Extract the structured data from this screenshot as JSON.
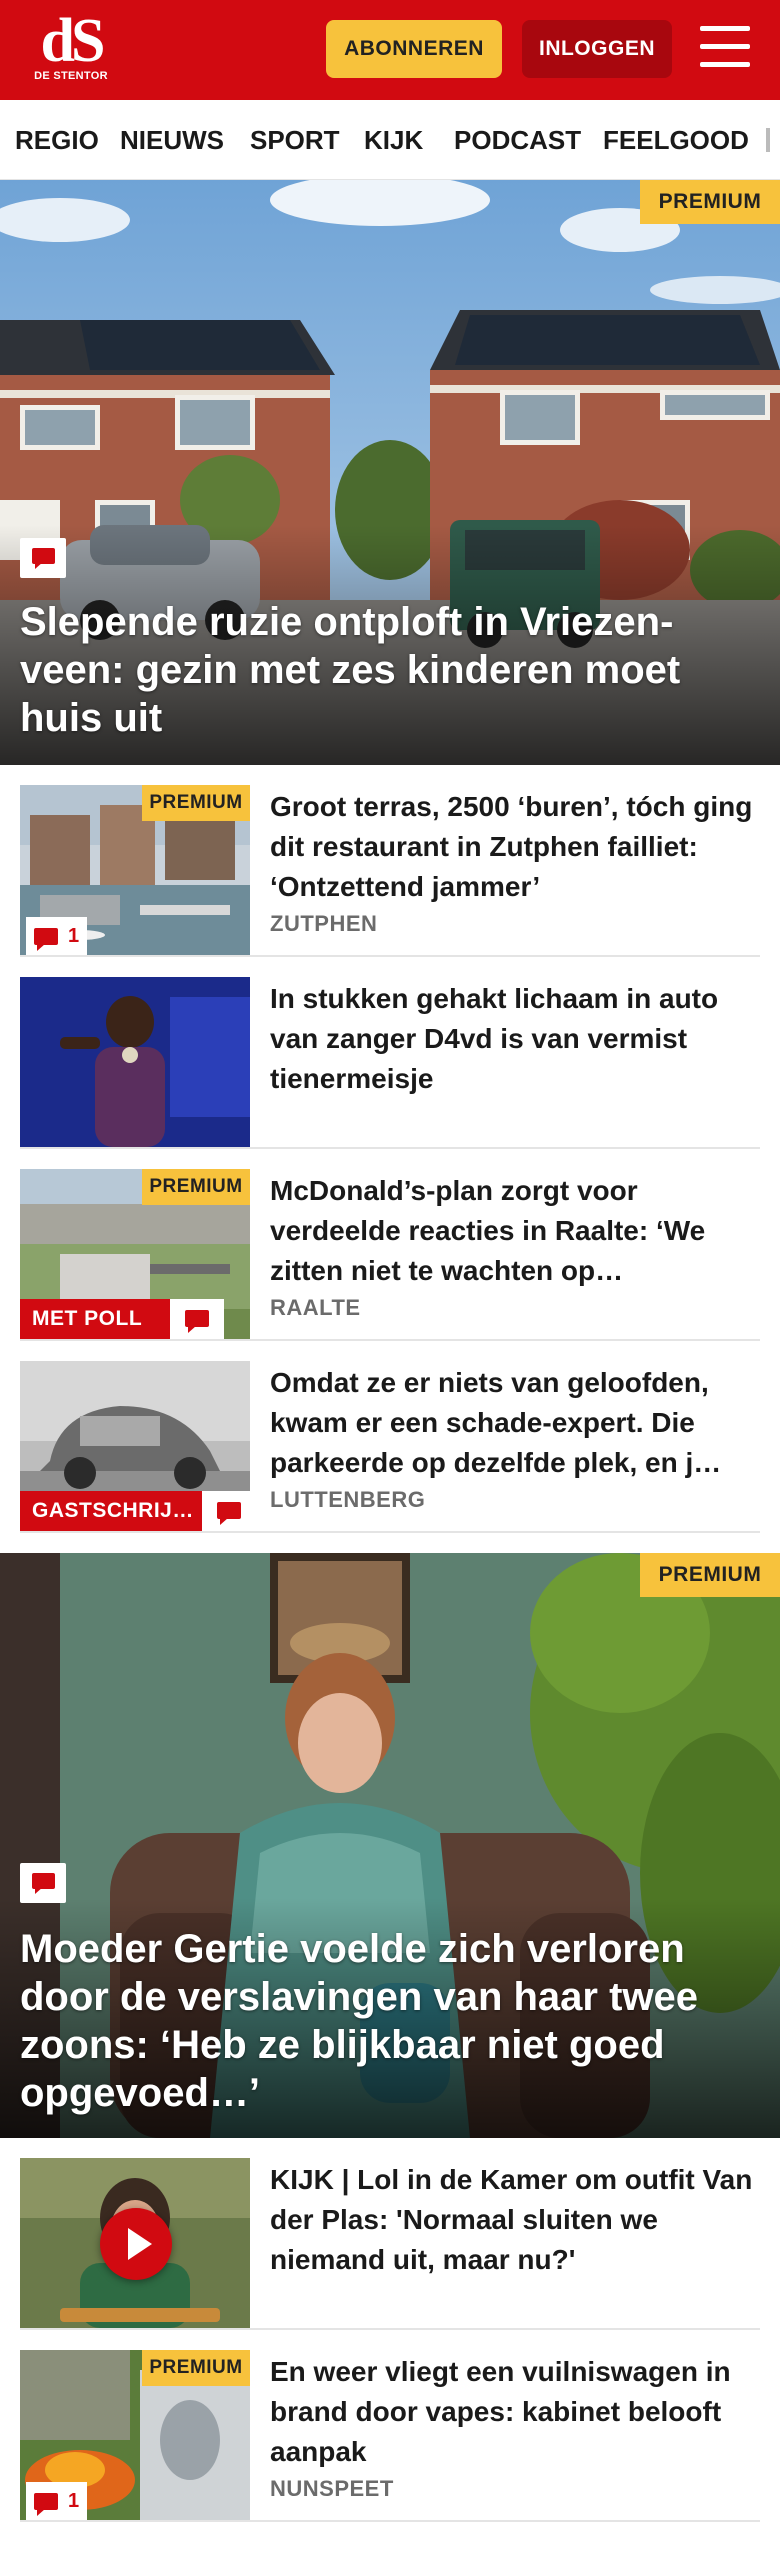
{
  "header": {
    "logo_mark": "dS",
    "logo_name": "DE STENTOR",
    "subscribe_label": "ABONNEREN",
    "login_label": "INLOGGEN",
    "brand_color": "#d10a11",
    "accent_color": "#f7c23c"
  },
  "nav": {
    "items": [
      "REGIO",
      "NIEUWS",
      "SPORT",
      "KIJK",
      "PODCAST",
      "FEELGOOD"
    ]
  },
  "badge": {
    "premium": "PREMIUM"
  },
  "hero1": {
    "title": "Slepende ruzie ontploft in Vriezen-veen: gezin met zes kinderen moet huis uit",
    "premium": true
  },
  "articles": [
    {
      "title": "Groot terras, 2500 ‘buren’, tóch ging dit restaurant in Zutphen failliet: ‘Ontzettend jammer’",
      "location": "ZUTPHEN",
      "premium": true,
      "comments": "1"
    },
    {
      "title": "In stukken gehakt lichaam in auto van zanger D4vd is van vermist tienermeisje",
      "location": "",
      "premium": false
    },
    {
      "title": "McDonald’s-plan zorgt voor verdeelde reacties in Raalte: ‘We zitten niet te wachten op…",
      "location": "RAALTE",
      "premium": true,
      "tag": "MET POLL"
    },
    {
      "title": "Omdat ze er niets van geloofden, kwam er een schade-expert. Die parkeerde op dezelfde plek, en j…",
      "location": "LUTTENBERG",
      "premium": false,
      "tag": "GASTSCHRIJ…"
    }
  ],
  "hero2": {
    "title": "Moeder Gertie voelde zich verloren door de verslavingen van haar twee zoons: ‘Heb ze blijkbaar niet goed opgevoed…’",
    "premium": true
  },
  "articles2": [
    {
      "title": "KIJK | Lol in de Kamer om outfit Van der Plas: 'Normaal sluiten we niemand uit, maar nu?'",
      "location": "",
      "premium": false,
      "video": true
    },
    {
      "title": "En weer vliegt een vuilniswagen in brand door vapes: kabinet belooft aanpak",
      "location": "NUNSPEET",
      "premium": true,
      "comments": "1"
    }
  ]
}
